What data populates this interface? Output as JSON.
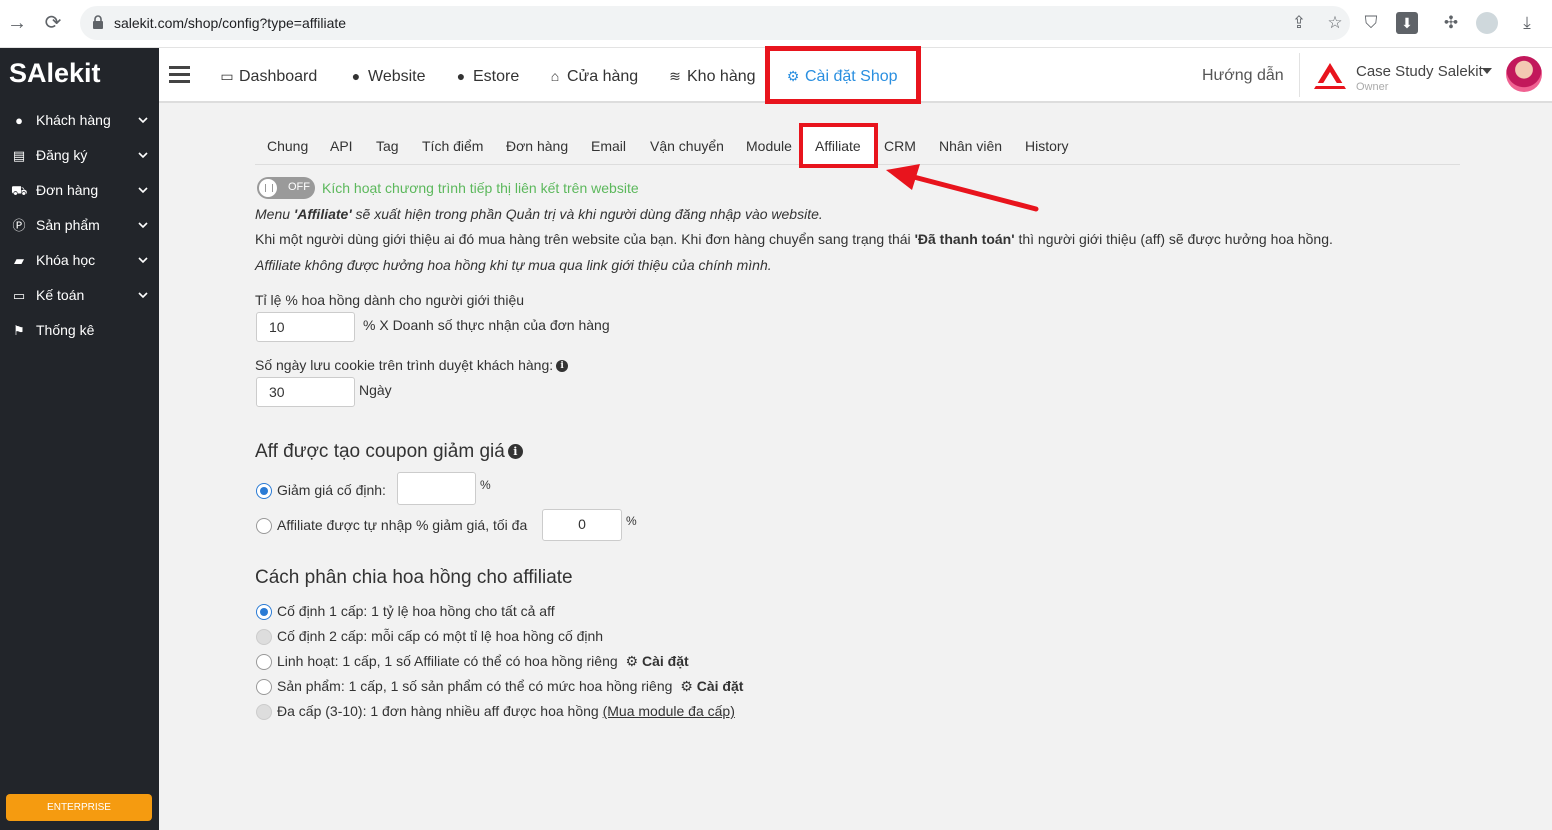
{
  "browser": {
    "url": "salekit.com/shop/config?type=affiliate"
  },
  "sidebar": {
    "logo": "SAlekit",
    "items": [
      {
        "label": "Khách hàng",
        "icon": "user-icon"
      },
      {
        "label": "Đăng ký",
        "icon": "list-icon"
      },
      {
        "label": "Đơn hàng",
        "icon": "cart-icon"
      },
      {
        "label": "Sản phẩm",
        "icon": "product-icon"
      },
      {
        "label": "Khóa học",
        "icon": "book-icon"
      },
      {
        "label": "Kế toán",
        "icon": "credit-card-icon"
      },
      {
        "label": "Thống kê",
        "icon": "flag-icon"
      }
    ],
    "plan_badge": "ENTERPRISE"
  },
  "topnav": {
    "items": [
      {
        "label": "Dashboard",
        "icon": "monitor-icon"
      },
      {
        "label": "Website",
        "icon": "globe-icon"
      },
      {
        "label": "Estore",
        "icon": "globe-icon"
      },
      {
        "label": "Cửa hàng",
        "icon": "store-icon"
      },
      {
        "label": "Kho hàng",
        "icon": "layers-icon"
      },
      {
        "label": "Cài đặt Shop",
        "icon": "gear-icon"
      }
    ],
    "guide": "Hướng dẫn",
    "shop_name": "Case Study Salekit",
    "shop_role": "Owner"
  },
  "tabs": [
    "Chung",
    "API",
    "Tag",
    "Tích điểm",
    "Đơn hàng",
    "Email",
    "Vận chuyển",
    "Module",
    "Affiliate",
    "CRM",
    "Nhân viên",
    "History"
  ],
  "content": {
    "toggle_state": "OFF",
    "toggle_label": "Kích hoạt chương trình tiếp thị liên kết trên website",
    "note1_a": "Menu ",
    "note1_b": "'Affiliate'",
    "note1_c": " sẽ xuất hiện trong phần Quản trị và khi người dùng đăng nhập vào website.",
    "note2_a": "Khi một người dùng giới thiệu ai đó mua hàng trên website của bạn. Khi đơn hàng chuyển sang trạng thái ",
    "note2_b": "'Đã thanh toán'",
    "note2_c": " thì người giới thiệu (aff) sẽ được hưởng hoa hồng.",
    "note3": "Affiliate không được hưởng hoa hồng khi tự mua qua link giới thiệu của chính mình.",
    "rate_label": "Tỉ lệ % hoa hồng dành cho người giới thiệu",
    "rate_value": "10",
    "rate_suffix": "% X Doanh số thực nhận của đơn hàng",
    "cookie_label": "Số ngày lưu cookie trên trình duyệt khách hàng:",
    "cookie_value": "30",
    "cookie_suffix": "Ngày",
    "coupon_title": "Aff được tạo coupon giảm giá",
    "coupon_fixed_label": "Giảm giá cố định:",
    "coupon_fixed_value": "",
    "coupon_fixed_unit": "%",
    "coupon_custom_label": "Affiliate được tự nhập % giảm giá, tối đa",
    "coupon_custom_value": "0",
    "coupon_custom_unit": "%",
    "split_title": "Cách phân chia hoa hồng cho affiliate",
    "split_options": [
      {
        "label": "Cố định 1 cấp: 1 tỷ lệ hoa hồng cho tất cả aff",
        "checked": true,
        "disabled": false
      },
      {
        "label": "Cố định 2 cấp: mỗi cấp có một tỉ lệ hoa hồng cố định",
        "checked": false,
        "disabled": true
      },
      {
        "label": "Linh hoạt: 1 cấp, 1 số Affiliate có thể có hoa hồng riêng",
        "checked": false,
        "disabled": false,
        "action": "Cài đặt"
      },
      {
        "label": "Sản phẩm: 1 cấp, 1 số sản phẩm có thể có mức hoa hồng riêng",
        "checked": false,
        "disabled": false,
        "action": "Cài đặt"
      },
      {
        "label": "Đa cấp (3-10): 1 đơn hàng nhiều aff được hoa hồng ",
        "checked": false,
        "disabled": true,
        "link": "(Mua module đa cấp)"
      }
    ]
  },
  "colors": {
    "sidebar_bg": "#22252a",
    "accent_blue": "#2a8fe0",
    "highlight_red": "#e8141d",
    "toggle_label_green": "#5cb85c",
    "enterprise_orange": "#f59b10"
  }
}
